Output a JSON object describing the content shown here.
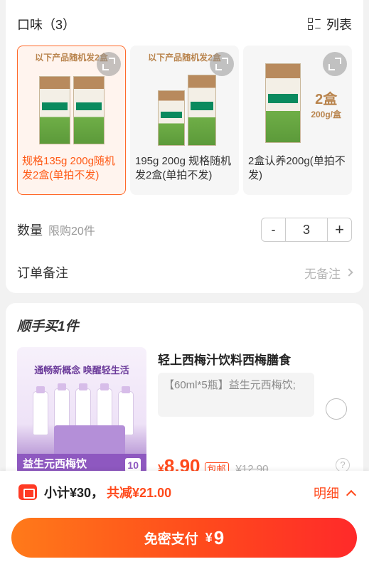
{
  "flavor": {
    "title": "口味（3）",
    "view_toggle_label": "列表",
    "options": [
      {
        "banner": "以下产品随机发2盒",
        "label": "规格135g 200g随机发2盒(单拍不发)",
        "selected": true
      },
      {
        "banner": "以下产品随机发2盒",
        "label": "195g 200g 规格随机发2盒(单拍不发)",
        "selected": false
      },
      {
        "banner": "",
        "label": "2盒认养200g(单拍不发)",
        "selected": false,
        "image_text_big": "2盒",
        "image_text_small": "200g/盒"
      }
    ]
  },
  "quantity": {
    "label": "数量",
    "limit_text": "限购20件",
    "minus": "-",
    "value": "3",
    "plus": "+"
  },
  "order_note": {
    "label": "订单备注",
    "value": "无备注"
  },
  "addon": {
    "title": "顺手买1件",
    "product": {
      "image_slogan": "通畅新概念 唤醒轻生活",
      "image_bottom_text": "益生元西梅饮",
      "image_badge": "10",
      "name": "轻上西梅汁饮料西梅膳食",
      "description": "【60ml*5瓶】益生元西梅饮;",
      "price_currency": "¥",
      "price_value": "8.90",
      "free_shipping_tag": "包邮",
      "original_price": "¥12.90"
    }
  },
  "summary": {
    "subtotal": "小计¥30，",
    "discount": "共减¥21.00",
    "detail_label": "明细"
  },
  "pay": {
    "label": "免密支付",
    "currency": "¥",
    "amount": "9"
  },
  "colors": {
    "accent": "#ff4a1c",
    "selected_border": "#ff6a2b",
    "banner_text": "#b9844d"
  }
}
